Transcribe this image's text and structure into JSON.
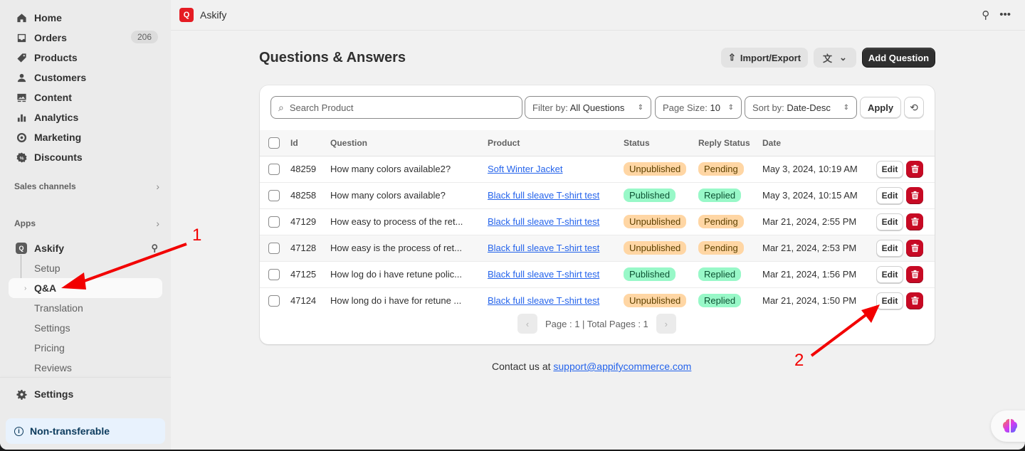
{
  "sidebar": {
    "nav": [
      {
        "label": "Home",
        "icon": "home-icon"
      },
      {
        "label": "Orders",
        "icon": "inbox-icon",
        "badge": "206"
      },
      {
        "label": "Products",
        "icon": "tag-icon"
      },
      {
        "label": "Customers",
        "icon": "person-icon"
      },
      {
        "label": "Content",
        "icon": "image-icon"
      },
      {
        "label": "Analytics",
        "icon": "bar-chart-icon"
      },
      {
        "label": "Marketing",
        "icon": "target-icon"
      },
      {
        "label": "Discounts",
        "icon": "discount-icon"
      }
    ],
    "sales_channels": "Sales channels",
    "apps": "Apps",
    "app_name": "Askify",
    "app_sub": [
      "Setup",
      "Q&A",
      "Translation",
      "Settings",
      "Pricing",
      "Reviews"
    ],
    "settings": "Settings",
    "non_transferable": "Non-transferable"
  },
  "topbar": {
    "app_title": "Askify"
  },
  "header": {
    "title": "Questions & Answers",
    "import_export": "Import/Export",
    "add_question": "Add Question"
  },
  "filters": {
    "search_placeholder": "Search Product",
    "filter_label": "Filter by:",
    "filter_value": "All Questions",
    "page_size_label": "Page Size:",
    "page_size_value": "10",
    "sort_label": "Sort by:",
    "sort_value": "Date-Desc",
    "apply": "Apply"
  },
  "table": {
    "columns": [
      "Id",
      "Question",
      "Product",
      "Status",
      "Reply Status",
      "Date"
    ],
    "edit_label": "Edit",
    "rows": [
      {
        "id": "48259",
        "question": "How many colors available2?",
        "product": "Soft Winter Jacket",
        "status": "Unpublished",
        "reply": "Pending",
        "date": "May 3, 2024, 10:19 AM"
      },
      {
        "id": "48258",
        "question": "How many colors available?",
        "product": "Black full sleave T-shirt test",
        "status": "Published",
        "reply": "Replied",
        "date": "May 3, 2024, 10:15 AM"
      },
      {
        "id": "47129",
        "question": "How easy to process of the ret...",
        "product": "Black full sleave T-shirt test",
        "status": "Unpublished",
        "reply": "Pending",
        "date": "Mar 21, 2024, 2:55 PM"
      },
      {
        "id": "47128",
        "question": "How easy is the process of ret...",
        "product": "Black full sleave T-shirt test",
        "status": "Unpublished",
        "reply": "Pending",
        "date": "Mar 21, 2024, 2:53 PM"
      },
      {
        "id": "47125",
        "question": "How log do i have retune polic...",
        "product": "Black full sleave T-shirt test",
        "status": "Published",
        "reply": "Replied",
        "date": "Mar 21, 2024, 1:56 PM"
      },
      {
        "id": "47124",
        "question": "How long do i have for retune ...",
        "product": "Black full sleave T-shirt test",
        "status": "Unpublished",
        "reply": "Replied",
        "date": "Mar 21, 2024, 1:50 PM"
      }
    ]
  },
  "pagination": {
    "text": "Page : 1 | Total Pages : 1"
  },
  "footer": {
    "contact_prefix": "Contact us at",
    "email": "support@appifycommerce.com"
  },
  "annotations": {
    "one": "1",
    "two": "2",
    "color": "#f20000"
  }
}
